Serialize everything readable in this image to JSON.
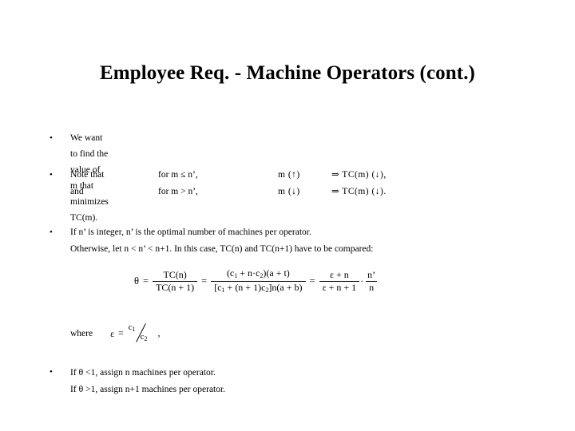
{
  "slide": {
    "title": "Employee Req. - Machine Operators (cont.)",
    "background_color": "#ffffff",
    "text_color": "#000000",
    "bullet_marker": "•"
  },
  "bullet1": {
    "text": "We want to find the value of m that minimizes TC(m)."
  },
  "bullet2": {
    "rows": [
      {
        "label": "Note that",
        "condition": "for  m ≤ n’,",
        "m_term": "m  (↑)",
        "result": "⇒  TC(m)  (↓),"
      },
      {
        "label": "and",
        "condition": "for  m > n’,",
        "m_term": "m  (↓)",
        "result": "⇒  TC(m)  (↓)."
      }
    ]
  },
  "bullet3": {
    "line1": "If n’ is integer, n’ is the optimal number of machines per operator.",
    "line2": "Otherwise, let  n < n’ < n+1. In this case, TC(n) and TC(n+1) have to be compared:"
  },
  "equation": {
    "lhs": "θ",
    "eq1": "=",
    "frac1_num": "TC(n)",
    "frac1_den": "TC(n + 1)",
    "eq2": "=",
    "frac2_num_a": "(c",
    "frac2_num_a_sub": "1",
    "frac2_num_b": " + n·c",
    "frac2_num_b_sub": "2",
    "frac2_num_c": ")(a + t)",
    "frac2_den_a": "[c",
    "frac2_den_a_sub": "1",
    "frac2_den_b": " + (n + 1)c",
    "frac2_den_b_sub": "2",
    "frac2_den_c": "]n(a + b)",
    "eq3": "=",
    "frac3_num": "ε + n",
    "frac3_den": "ε + n + 1",
    "dot": "·",
    "frac4_num": "n’",
    "frac4_den": "n"
  },
  "where": {
    "label": "where",
    "symbol": "ε",
    "equals": "=",
    "numerator": "c",
    "numerator_sub": "1",
    "denominator": "c",
    "denominator_sub": "2",
    "trailing": ","
  },
  "bullet4": {
    "line1_pre": "If  ",
    "line1_theta": "θ",
    "line1_post": " <1,  assign n machines per operator.",
    "line2_pre": "If  ",
    "line2_theta": "θ",
    "line2_post": " >1,  assign n+1 machines per operator."
  }
}
